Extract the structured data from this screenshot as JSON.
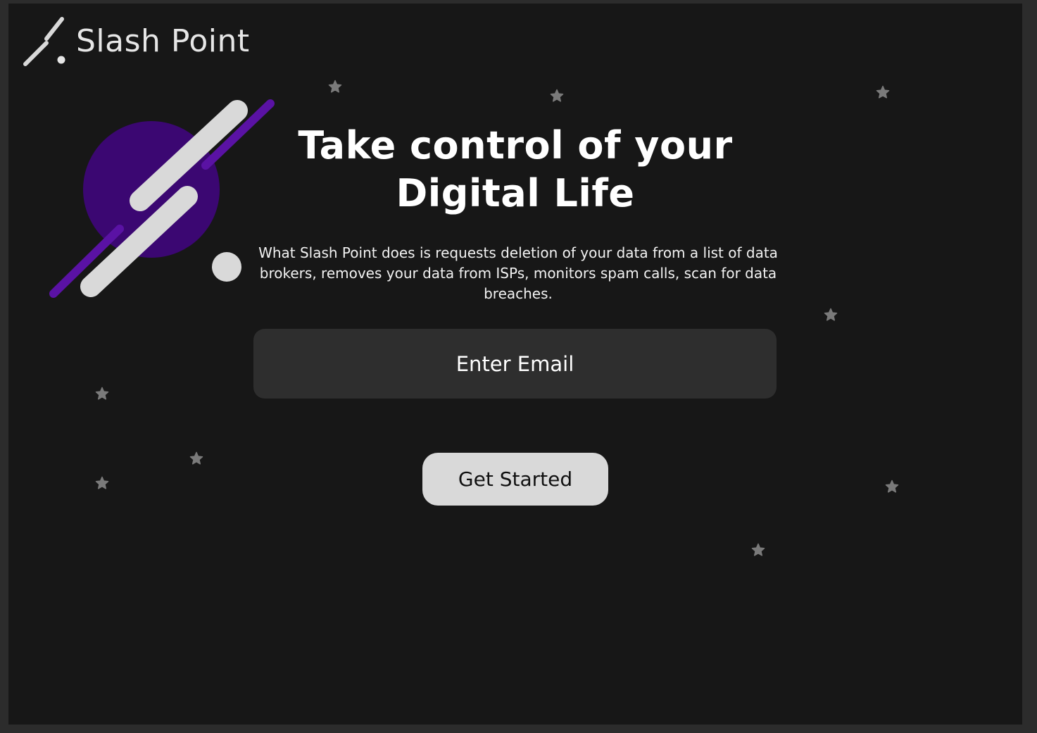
{
  "brand": {
    "name": "Slash Point",
    "logo_icon": "slash-point-logo-icon"
  },
  "hero": {
    "headline": "Take control of your Digital Life",
    "description": "What Slash Point does is requests deletion of your data from a list of data brokers, removes your data from ISPs, monitors spam calls, scan for data breaches.",
    "illustration_icon": "slash-planet-illustration"
  },
  "signup": {
    "email_placeholder": "Enter Email",
    "submit_label": "Get Started"
  },
  "decorations": {
    "star_icon": "star-icon",
    "star_count": 10
  },
  "colors": {
    "background": "#171717",
    "accent_purple": "#5a12a4",
    "planet_purple": "#3b0772",
    "light": "#d9d9d9",
    "input_background": "#2e2e2e",
    "star": "#7a7a7a"
  }
}
